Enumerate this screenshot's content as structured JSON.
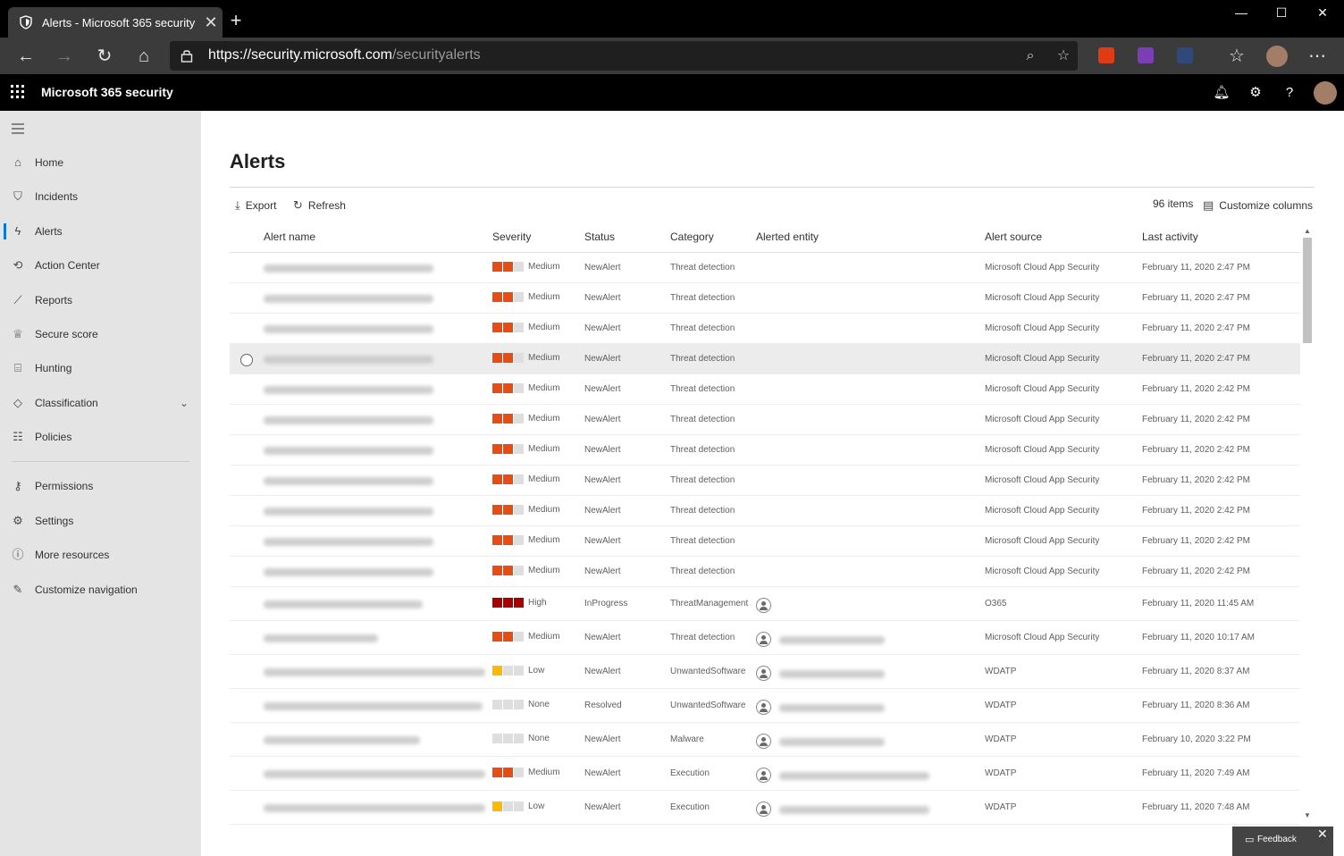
{
  "browser": {
    "tab_title": "Alerts - Microsoft 365 security",
    "tab_close": "✕",
    "new_tab": "+",
    "window_controls": {
      "minimize": "—",
      "maximize": "☐",
      "close": "✕"
    },
    "url_host": "https://security.microsoft.com",
    "url_path": "/securityalerts"
  },
  "app": {
    "title": "Microsoft 365 security"
  },
  "nav": {
    "items": [
      {
        "label": "Home",
        "icon": "home-icon"
      },
      {
        "label": "Incidents",
        "icon": "shield-icon"
      },
      {
        "label": "Alerts",
        "icon": "lightning-icon",
        "active": true
      },
      {
        "label": "Action Center",
        "icon": "action-center-icon"
      },
      {
        "label": "Reports",
        "icon": "chart-icon"
      },
      {
        "label": "Secure score",
        "icon": "trophy-icon"
      },
      {
        "label": "Hunting",
        "icon": "hunting-icon"
      },
      {
        "label": "Classification",
        "icon": "tag-icon",
        "expandable": true
      },
      {
        "label": "Policies",
        "icon": "sliders-icon"
      },
      {
        "label": "Permissions",
        "icon": "key-icon"
      },
      {
        "label": "Settings",
        "icon": "gear-icon"
      },
      {
        "label": "More resources",
        "icon": "info-icon"
      },
      {
        "label": "Customize navigation",
        "icon": "pencil-icon"
      }
    ]
  },
  "page": {
    "title": "Alerts",
    "export_label": "Export",
    "refresh_label": "Refresh",
    "item_count": "96 items",
    "customize_label": "Customize columns"
  },
  "table": {
    "columns": [
      "Alert name",
      "Severity",
      "Status",
      "Category",
      "Alerted entity",
      "Alert source",
      "Last activity"
    ],
    "rows": [
      {
        "severity": "Medium",
        "status": "NewAlert",
        "category": "Threat detection",
        "entity": false,
        "source": "Microsoft Cloud App Security",
        "last": "February 11, 2020 2:47 PM"
      },
      {
        "severity": "Medium",
        "status": "NewAlert",
        "category": "Threat detection",
        "entity": false,
        "source": "Microsoft Cloud App Security",
        "last": "February 11, 2020 2:47 PM"
      },
      {
        "severity": "Medium",
        "status": "NewAlert",
        "category": "Threat detection",
        "entity": false,
        "source": "Microsoft Cloud App Security",
        "last": "February 11, 2020 2:47 PM"
      },
      {
        "severity": "Medium",
        "status": "NewAlert",
        "category": "Threat detection",
        "entity": false,
        "source": "Microsoft Cloud App Security",
        "last": "February 11, 2020 2:47 PM",
        "highlight": true
      },
      {
        "severity": "Medium",
        "status": "NewAlert",
        "category": "Threat detection",
        "entity": false,
        "source": "Microsoft Cloud App Security",
        "last": "February 11, 2020 2:42 PM"
      },
      {
        "severity": "Medium",
        "status": "NewAlert",
        "category": "Threat detection",
        "entity": false,
        "source": "Microsoft Cloud App Security",
        "last": "February 11, 2020 2:42 PM"
      },
      {
        "severity": "Medium",
        "status": "NewAlert",
        "category": "Threat detection",
        "entity": false,
        "source": "Microsoft Cloud App Security",
        "last": "February 11, 2020 2:42 PM"
      },
      {
        "severity": "Medium",
        "status": "NewAlert",
        "category": "Threat detection",
        "entity": false,
        "source": "Microsoft Cloud App Security",
        "last": "February 11, 2020 2:42 PM"
      },
      {
        "severity": "Medium",
        "status": "NewAlert",
        "category": "Threat detection",
        "entity": false,
        "source": "Microsoft Cloud App Security",
        "last": "February 11, 2020 2:42 PM"
      },
      {
        "severity": "Medium",
        "status": "NewAlert",
        "category": "Threat detection",
        "entity": false,
        "source": "Microsoft Cloud App Security",
        "last": "February 11, 2020 2:42 PM"
      },
      {
        "severity": "Medium",
        "status": "NewAlert",
        "category": "Threat detection",
        "entity": false,
        "source": "Microsoft Cloud App Security",
        "last": "February 11, 2020 2:42 PM"
      },
      {
        "severity": "High",
        "status": "InProgress",
        "category": "ThreatManagement",
        "entity": true,
        "source": "O365",
        "last": "February 11, 2020 11:45 AM"
      },
      {
        "severity": "Medium",
        "status": "NewAlert",
        "category": "Threat detection",
        "entity": true,
        "source": "Microsoft Cloud App Security",
        "last": "February 11, 2020 10:17 AM"
      },
      {
        "severity": "Low",
        "status": "NewAlert",
        "category": "UnwantedSoftware",
        "entity": true,
        "source": "WDATP",
        "last": "February 11, 2020 8:37 AM"
      },
      {
        "severity": "None",
        "status": "Resolved",
        "category": "UnwantedSoftware",
        "entity": true,
        "source": "WDATP",
        "last": "February 11, 2020 8:36 AM"
      },
      {
        "severity": "None",
        "status": "NewAlert",
        "category": "Malware",
        "entity": true,
        "source": "WDATP",
        "last": "February 10, 2020 3:22 PM"
      },
      {
        "severity": "Medium",
        "status": "NewAlert",
        "category": "Execution",
        "entity": true,
        "source": "WDATP",
        "last": "February 11, 2020 7:49 AM"
      },
      {
        "severity": "Low",
        "status": "NewAlert",
        "category": "Execution",
        "entity": true,
        "source": "WDATP",
        "last": "February 11, 2020 7:48 AM"
      }
    ]
  },
  "severity_colors": {
    "High": [
      "#a80000",
      "#a80000",
      "#a80000"
    ],
    "Medium": [
      "#e74c13",
      "#e74c13",
      "#dedede"
    ],
    "Low": [
      "#fcb900",
      "#dedede",
      "#dedede"
    ],
    "None": [
      "#dedede",
      "#dedede",
      "#dedede"
    ]
  },
  "feedback": {
    "label": "Feedback",
    "close": "✕"
  }
}
